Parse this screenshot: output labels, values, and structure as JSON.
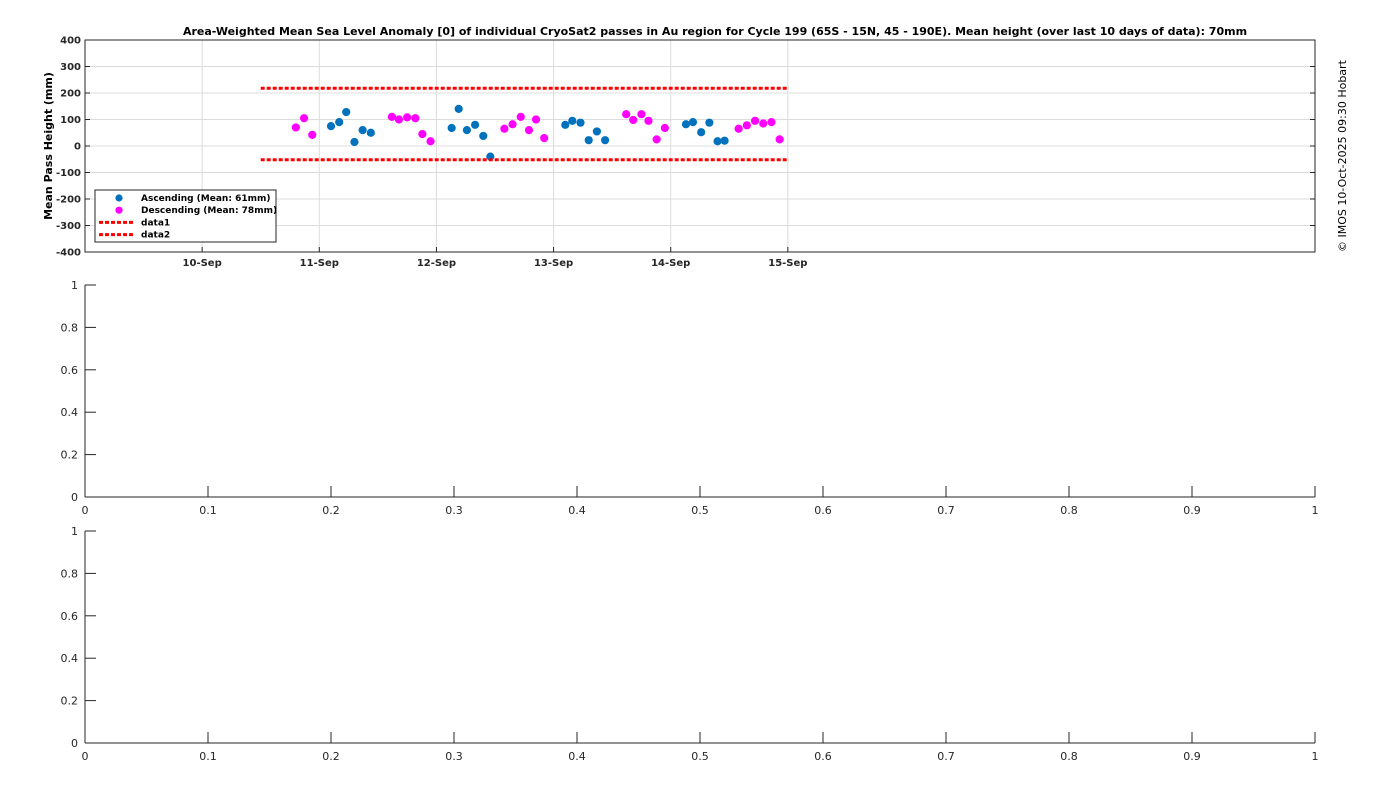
{
  "credit": "© IMOS 10-Oct-2025 09:30 Hobart",
  "chart_data": [
    {
      "type": "scatter",
      "title": "Area-Weighted Mean Sea Level Anomaly [0] of individual CryoSat2 passes in Au region for Cycle 199 (65S - 15N, 45 - 190E). Mean height (over last 10 days of data): 70mm",
      "ylabel": "Mean Pass Height (mm)",
      "xlabel": "",
      "ylim": [
        -400,
        400
      ],
      "yticks": [
        400,
        300,
        200,
        100,
        0,
        -100,
        -200,
        -300,
        -400
      ],
      "xlim_days": [
        9.0,
        19.5
      ],
      "xticks": [
        {
          "day": 10,
          "label": "10-Sep"
        },
        {
          "day": 11,
          "label": "11-Sep"
        },
        {
          "day": 12,
          "label": "12-Sep"
        },
        {
          "day": 13,
          "label": "13-Sep"
        },
        {
          "day": 14,
          "label": "14-Sep"
        },
        {
          "day": 15,
          "label": "15-Sep"
        }
      ],
      "grid": true,
      "legend_position": "bottom-left",
      "series": [
        {
          "name": "Ascending (Mean: 61mm)",
          "color": "#0072BD",
          "marker": "circle",
          "points": [
            {
              "x": 11.1,
              "y": 75
            },
            {
              "x": 11.17,
              "y": 90
            },
            {
              "x": 11.23,
              "y": 128
            },
            {
              "x": 11.3,
              "y": 15
            },
            {
              "x": 11.37,
              "y": 60
            },
            {
              "x": 11.44,
              "y": 50
            },
            {
              "x": 12.13,
              "y": 68
            },
            {
              "x": 12.19,
              "y": 140
            },
            {
              "x": 12.26,
              "y": 60
            },
            {
              "x": 12.33,
              "y": 80
            },
            {
              "x": 12.4,
              "y": 38
            },
            {
              "x": 12.46,
              "y": -40
            },
            {
              "x": 13.1,
              "y": 80
            },
            {
              "x": 13.16,
              "y": 95
            },
            {
              "x": 13.23,
              "y": 88
            },
            {
              "x": 13.3,
              "y": 22
            },
            {
              "x": 13.37,
              "y": 55
            },
            {
              "x": 13.44,
              "y": 22
            },
            {
              "x": 14.13,
              "y": 82
            },
            {
              "x": 14.19,
              "y": 90
            },
            {
              "x": 14.26,
              "y": 52
            },
            {
              "x": 14.33,
              "y": 88
            },
            {
              "x": 14.4,
              "y": 18
            },
            {
              "x": 14.46,
              "y": 20
            }
          ]
        },
        {
          "name": "Descending (Mean: 78mm)",
          "color": "#FF00FF",
          "marker": "circle",
          "points": [
            {
              "x": 10.8,
              "y": 70
            },
            {
              "x": 10.87,
              "y": 105
            },
            {
              "x": 10.94,
              "y": 42
            },
            {
              "x": 11.62,
              "y": 110
            },
            {
              "x": 11.68,
              "y": 100
            },
            {
              "x": 11.75,
              "y": 108
            },
            {
              "x": 11.82,
              "y": 105
            },
            {
              "x": 11.88,
              "y": 45
            },
            {
              "x": 11.95,
              "y": 18
            },
            {
              "x": 12.58,
              "y": 65
            },
            {
              "x": 12.65,
              "y": 82
            },
            {
              "x": 12.72,
              "y": 110
            },
            {
              "x": 12.79,
              "y": 60
            },
            {
              "x": 12.85,
              "y": 100
            },
            {
              "x": 12.92,
              "y": 30
            },
            {
              "x": 13.62,
              "y": 120
            },
            {
              "x": 13.68,
              "y": 98
            },
            {
              "x": 13.75,
              "y": 120
            },
            {
              "x": 13.81,
              "y": 95
            },
            {
              "x": 13.88,
              "y": 25
            },
            {
              "x": 13.95,
              "y": 68
            },
            {
              "x": 14.58,
              "y": 65
            },
            {
              "x": 14.65,
              "y": 78
            },
            {
              "x": 14.72,
              "y": 95
            },
            {
              "x": 14.79,
              "y": 85
            },
            {
              "x": 14.86,
              "y": 90
            },
            {
              "x": 14.93,
              "y": 25
            }
          ]
        },
        {
          "name": "data1",
          "color": "#FF0000",
          "line": "dotted",
          "points": [
            {
              "x": 10.5,
              "y": 218
            },
            {
              "x": 15.0,
              "y": 218
            }
          ]
        },
        {
          "name": "data2",
          "color": "#FF0000",
          "line": "dotted",
          "points": [
            {
              "x": 10.5,
              "y": -52
            },
            {
              "x": 15.0,
              "y": -52
            }
          ]
        }
      ]
    },
    {
      "type": "line",
      "title": "",
      "xlim": [
        0,
        1
      ],
      "ylim": [
        0,
        1
      ],
      "xticks": [
        "0",
        "0.1",
        "0.2",
        "0.3",
        "0.4",
        "0.5",
        "0.6",
        "0.7",
        "0.8",
        "0.9",
        "1"
      ],
      "yticks": [
        "0",
        "0.2",
        "0.4",
        "0.6",
        "0.8",
        "1"
      ],
      "series": []
    },
    {
      "type": "line",
      "title": "",
      "xlim": [
        0,
        1
      ],
      "ylim": [
        0,
        1
      ],
      "xticks": [
        "0",
        "0.1",
        "0.2",
        "0.3",
        "0.4",
        "0.5",
        "0.6",
        "0.7",
        "0.8",
        "0.9",
        "1"
      ],
      "yticks": [
        "0",
        "0.2",
        "0.4",
        "0.6",
        "0.8",
        "1"
      ],
      "series": []
    }
  ]
}
